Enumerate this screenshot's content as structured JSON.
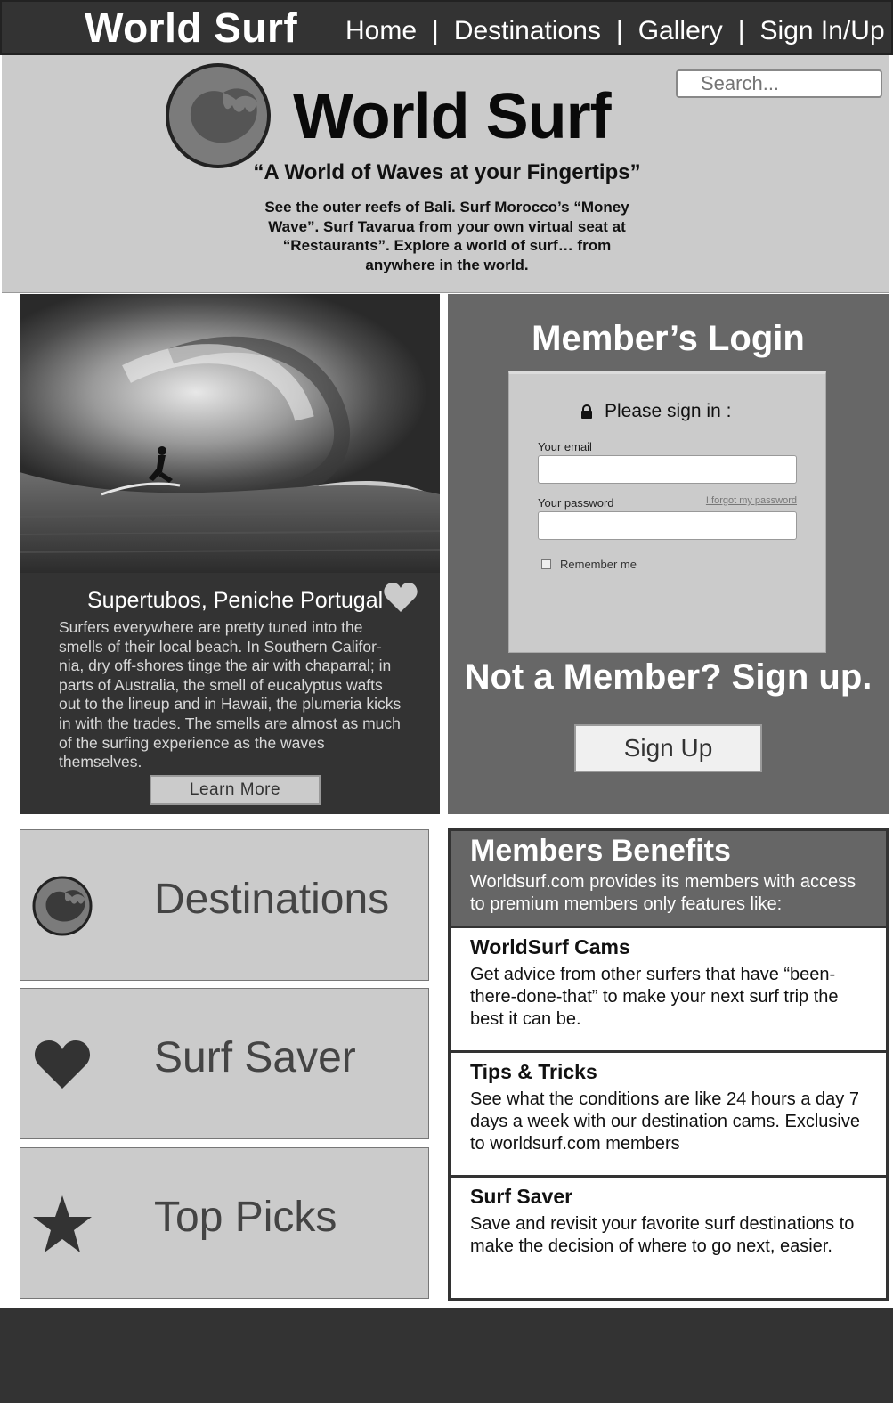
{
  "nav": {
    "brand": "World Surf",
    "links": [
      "Home",
      "Destinations",
      "Gallery",
      "Sign In/Up"
    ],
    "separator": "|"
  },
  "hero": {
    "title": "World Surf",
    "tagline": "“A World of Waves at your Fingertips”",
    "description": "See the outer reefs of Bali. Surf Morocco’s “Money Wave”. Surf Tavarua from your own virtual seat at “Restaurants”. Explore a world of surf… from anywhere in the world.",
    "search_placeholder": "Search..."
  },
  "feature": {
    "title": "Supertubos, Peniche Portugal",
    "text": "Surfers everywhere are pretty tuned into the smells of their local beach. In Southern Califor-nia, dry off-shores tinge the air with chaparral; in parts of Australia, the smell of eucalyptus wafts out to the lineup and in Hawaii, the plumeria kicks in with the trades. The smells are almost as much of the surfing experience as the waves themselves.",
    "button": "Learn More"
  },
  "login": {
    "title": "Member’s Login",
    "signin_prompt": "Please sign in :",
    "email_label": "Your email",
    "password_label": "Your password",
    "forgot": "I forgot my password",
    "remember": "Remember me",
    "not_member": "Not a Member? Sign up.",
    "signup_button": "Sign Up"
  },
  "quicklinks": [
    {
      "label": "Destinations",
      "icon": "wave-logo-icon"
    },
    {
      "label": "Surf Saver",
      "icon": "heart-icon"
    },
    {
      "label": "Top Picks",
      "icon": "star-icon"
    }
  ],
  "benefits": {
    "title": "Members Benefits",
    "subtitle": "Worldsurf.com provides its members with access to premium members only features like:",
    "items": [
      {
        "title": "WorldSurf Cams",
        "text": "Get advice from other surfers that have “been-there-done-that” to make your next surf trip the best it can be."
      },
      {
        "title": "Tips & Tricks",
        "text": "See what the conditions are like 24 hours a day 7 days a week with our destination cams. Exclusive to worldsurf.com members"
      },
      {
        "title": "Surf Saver",
        "text": "Save and revisit your favorite surf destinations to make the decision of where to go next, easier."
      }
    ]
  },
  "colors": {
    "dark": "#333333",
    "mid": "#676767",
    "light": "#cbcbcb"
  }
}
